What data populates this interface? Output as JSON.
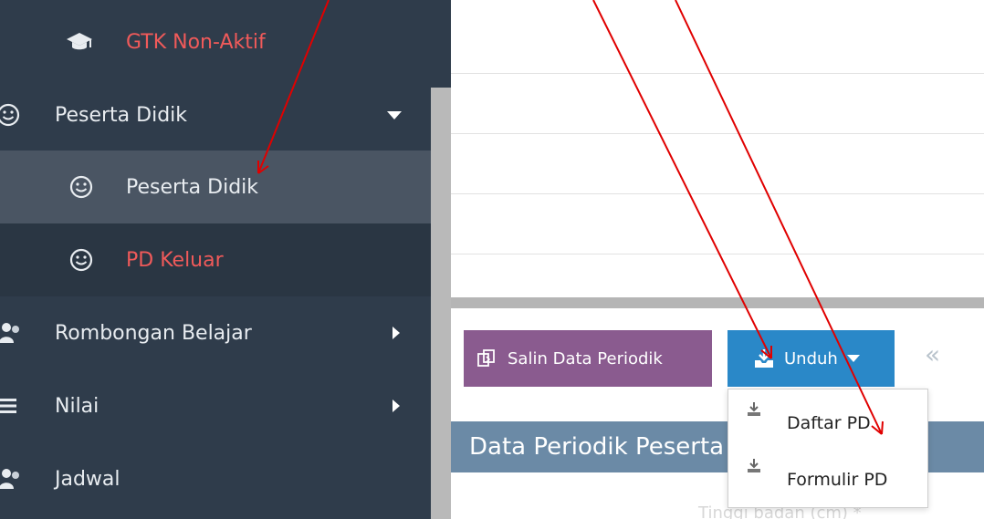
{
  "sidebar": {
    "items": [
      {
        "label": "GTK Non-Aktif",
        "icon": "graduation-cap-icon"
      },
      {
        "label": "Peserta Didik",
        "icon": "smile-icon"
      },
      {
        "label": "Peserta Didik",
        "icon": "smile-icon"
      },
      {
        "label": "PD Keluar",
        "icon": "smile-icon"
      },
      {
        "label": "Rombongan Belajar",
        "icon": "users-icon"
      },
      {
        "label": "Nilai",
        "icon": "list-icon"
      },
      {
        "label": "Jadwal",
        "icon": "users-icon"
      }
    ]
  },
  "toolbar": {
    "salin_label": "Salin Data Periodik",
    "unduh_label": "Unduh",
    "collapse_glyph": "«"
  },
  "dropdown": {
    "items": [
      {
        "label": "Daftar PD",
        "icon": "download-icon"
      },
      {
        "label": "Formulir PD",
        "icon": "download-icon"
      }
    ]
  },
  "panel": {
    "title": "Data Periodik Peserta",
    "faint_label": "Tinggi badan (cm) *"
  },
  "colors": {
    "sidebar_bg": "#2f3c4b",
    "sidebar_active": "#4a5563",
    "sidebar_red_text": "#f05a5a",
    "salin_button": "#8a5b8f",
    "unduh_button": "#2a88c8",
    "panel_header": "#6b8aa6",
    "annotation_arrow": "#e00000"
  }
}
